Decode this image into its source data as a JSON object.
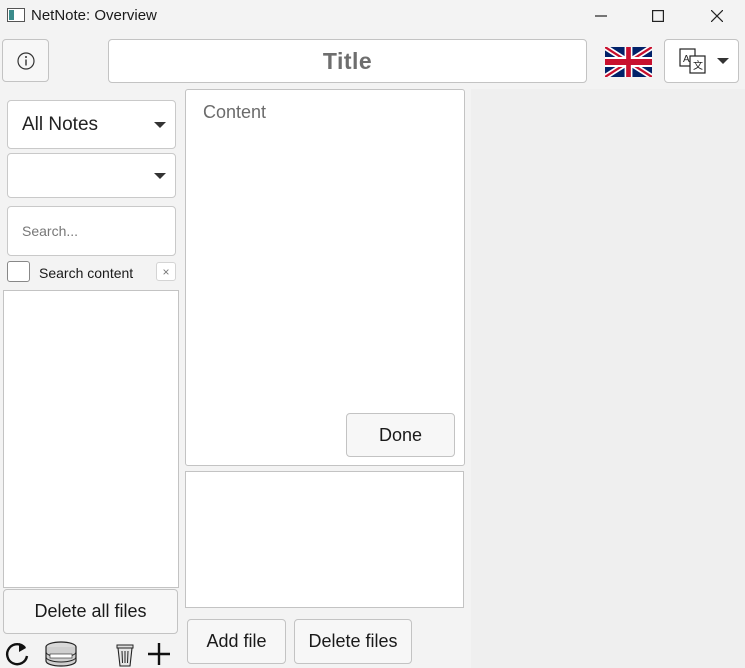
{
  "window": {
    "title": "NetNote: Overview",
    "controls": [
      "minimize",
      "maximize",
      "close"
    ]
  },
  "header": {
    "info_icon": "info-circle-icon",
    "title_placeholder": "Title",
    "flag": "uk-flag-icon",
    "language_icon": "translate-icon"
  },
  "sidebar": {
    "collection_dropdown": {
      "selected": "All Notes"
    },
    "tag_dropdown": {
      "selected": ""
    },
    "search": {
      "placeholder": "Search...",
      "value": ""
    },
    "search_content_label": "Search content",
    "search_content_checked": false,
    "clear_label": "×",
    "notes": [],
    "delete_all_label": "Delete all files",
    "toolbar": [
      "refresh-icon",
      "database-icon",
      "trash-icon",
      "plus-icon"
    ]
  },
  "editor": {
    "content_placeholder": "Content",
    "done_label": "Done",
    "files": [],
    "add_file_label": "Add file",
    "delete_files_label": "Delete files"
  },
  "colors": {
    "background": "#f3f3f3",
    "panel": "#ffffff",
    "border": "#c3c3c3"
  }
}
